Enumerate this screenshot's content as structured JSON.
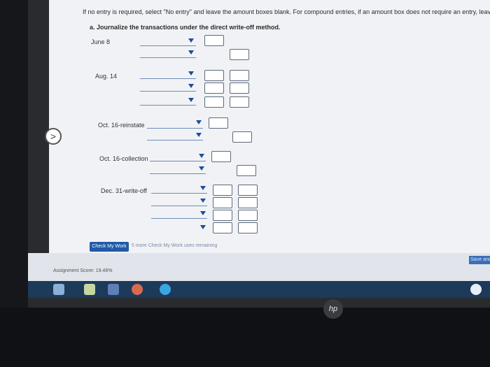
{
  "instructions": "If no entry is required, select \"No entry\" and leave the amount boxes blank. For compound entries, if an amount box does not require an entry, leave it blank.",
  "part": "a.  Journalize the transactions under the direct write-off method.",
  "entries": [
    {
      "label": "June 8"
    },
    {
      "label": "Aug. 14"
    },
    {
      "label": "Oct. 16-reinstate"
    },
    {
      "label": "Oct. 16-collection"
    },
    {
      "label": "Dec. 31-write-off"
    }
  ],
  "nav_glyph": ">",
  "check_button": "Check My Work",
  "remaining": "5 more Check My Work uses remaining",
  "score": "Assignment Score: 19.46%",
  "save_button": "Save and",
  "hp_logo": "hp",
  "colors": {
    "accent": "#1f5aa6",
    "line": "#6c8db8"
  }
}
